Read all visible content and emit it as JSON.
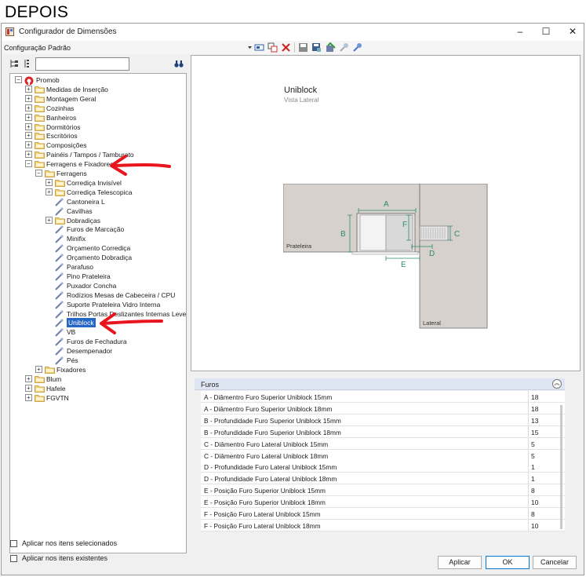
{
  "heading": "DEPOIS",
  "window": {
    "title": "Configurador de Dimensões",
    "controls": {
      "minimize": "–",
      "maximize": "☐",
      "close": "✕"
    }
  },
  "config_bar": {
    "label": "Configuração Padrão"
  },
  "tree": {
    "root": "Promob",
    "items": [
      "Medidas de Inserção",
      "Montagem Geral",
      "Cozinhas",
      "Banheiros",
      "Dormitórios",
      "Escritórios",
      "Composições",
      "Painéis / Tampos / Tamburato",
      "Ferragens e Fixadores",
      "Ferragens",
      "Corrediça Invisível",
      "Corrediça Telescopica",
      "Cantoneira L",
      "Cavilhas",
      "Dobradiças",
      "Furos de Marcação",
      "Minifix",
      "Orçamento Corrediça",
      "Orçamento Dobradiça",
      "Parafuso",
      "Pino Prateleira",
      "Puxador Concha",
      "Rodízios Mesas de Cabeceira / CPU",
      "Suporte Prateleira Vidro Interna",
      "Trilhos Portas Deslizantes Internas Leves",
      "Uniblock",
      "VB",
      "Furos de Fechadura",
      "Desempenador",
      "Pés",
      "Fixadores",
      "Blum",
      "Hafele",
      "FGVTN"
    ]
  },
  "preview": {
    "title": "Uniblock",
    "subtitle": "Vista Lateral",
    "labels": {
      "a": "A",
      "b": "B",
      "c": "C",
      "d": "D",
      "e": "E",
      "f": "F",
      "prateleira": "Prateleira",
      "lateral": "Lateral"
    },
    "accent": "#2e8b6e"
  },
  "properties": {
    "group": "Furos",
    "rows": [
      {
        "name": "A - Diâmentro Furo Superior Uniblock 15mm",
        "value": "18"
      },
      {
        "name": "A - Diâmentro Furo Superior Uniblock 18mm",
        "value": "18"
      },
      {
        "name": "B - Profundidade Furo Superior Uniblock 15mm",
        "value": "13"
      },
      {
        "name": "B - Profundidade Furo Superior Uniblock 18mm",
        "value": "15"
      },
      {
        "name": "C - Diâmentro Furo Lateral Uniblock 15mm",
        "value": "5"
      },
      {
        "name": "C - Diâmentro Furo Lateral Uniblock 18mm",
        "value": "5"
      },
      {
        "name": "D - Profundidade Furo Lateral Uniblock 15mm",
        "value": "1"
      },
      {
        "name": "D - Profundidade Furo Lateral Uniblock 18mm",
        "value": "1"
      },
      {
        "name": "E - Posição Furo Superior Uniblock 15mm",
        "value": "8"
      },
      {
        "name": "E - Posição Furo Superior Uniblock 18mm",
        "value": "10"
      },
      {
        "name": "F - Posição Furo Lateral Uniblock 15mm",
        "value": "8"
      },
      {
        "name": "F - Posição Furo Lateral Uniblock 18mm",
        "value": "10"
      }
    ]
  },
  "options": {
    "apply_selected": "Aplicar nos itens selecionados",
    "apply_existing": "Aplicar nos itens existentes"
  },
  "buttons": {
    "apply": "Aplicar",
    "ok": "OK",
    "cancel": "Cancelar"
  },
  "colors": {
    "selection": "#2666c4",
    "annotation_arrow": "#e8141e",
    "panel": "#d6d1cc"
  }
}
